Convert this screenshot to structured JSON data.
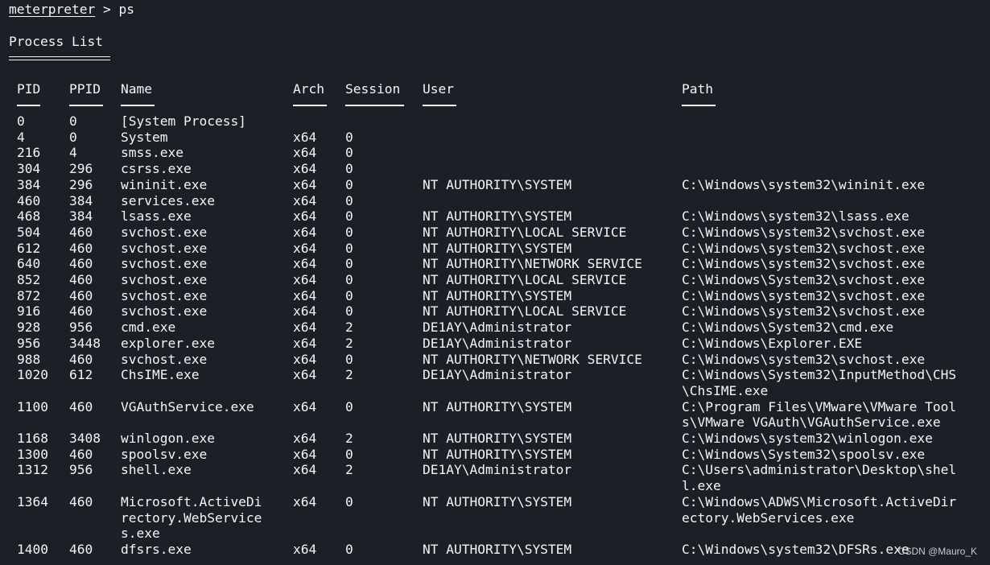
{
  "prompt": {
    "name": "meterpreter",
    "separator": " > ",
    "command": "ps"
  },
  "heading": "Process List",
  "columns": [
    {
      "key": "pid",
      "label": "PID"
    },
    {
      "key": "ppid",
      "label": "PPID"
    },
    {
      "key": "name",
      "label": "Name"
    },
    {
      "key": "arch",
      "label": "Arch"
    },
    {
      "key": "session",
      "label": "Session"
    },
    {
      "key": "user",
      "label": "User"
    },
    {
      "key": "path",
      "label": "Path"
    }
  ],
  "rows": [
    {
      "pid": "0",
      "ppid": "0",
      "name": [
        "[System Process]"
      ],
      "arch": "",
      "session": "",
      "user": "",
      "path": []
    },
    {
      "pid": "4",
      "ppid": "0",
      "name": [
        "System"
      ],
      "arch": "x64",
      "session": "0",
      "user": "",
      "path": []
    },
    {
      "pid": "216",
      "ppid": "4",
      "name": [
        "smss.exe"
      ],
      "arch": "x64",
      "session": "0",
      "user": "",
      "path": []
    },
    {
      "pid": "304",
      "ppid": "296",
      "name": [
        "csrss.exe"
      ],
      "arch": "x64",
      "session": "0",
      "user": "",
      "path": []
    },
    {
      "pid": "384",
      "ppid": "296",
      "name": [
        "wininit.exe"
      ],
      "arch": "x64",
      "session": "0",
      "user": "NT AUTHORITY\\SYSTEM",
      "path": [
        "C:\\Windows\\system32\\wininit.exe"
      ]
    },
    {
      "pid": "460",
      "ppid": "384",
      "name": [
        "services.exe"
      ],
      "arch": "x64",
      "session": "0",
      "user": "",
      "path": []
    },
    {
      "pid": "468",
      "ppid": "384",
      "name": [
        "lsass.exe"
      ],
      "arch": "x64",
      "session": "0",
      "user": "NT AUTHORITY\\SYSTEM",
      "path": [
        "C:\\Windows\\system32\\lsass.exe"
      ]
    },
    {
      "pid": "504",
      "ppid": "460",
      "name": [
        "svchost.exe"
      ],
      "arch": "x64",
      "session": "0",
      "user": "NT AUTHORITY\\LOCAL SERVICE",
      "path": [
        "C:\\Windows\\system32\\svchost.exe"
      ]
    },
    {
      "pid": "612",
      "ppid": "460",
      "name": [
        "svchost.exe"
      ],
      "arch": "x64",
      "session": "0",
      "user": "NT AUTHORITY\\SYSTEM",
      "path": [
        "C:\\Windows\\system32\\svchost.exe"
      ]
    },
    {
      "pid": "640",
      "ppid": "460",
      "name": [
        "svchost.exe"
      ],
      "arch": "x64",
      "session": "0",
      "user": "NT AUTHORITY\\NETWORK SERVICE",
      "path": [
        "C:\\Windows\\system32\\svchost.exe"
      ]
    },
    {
      "pid": "852",
      "ppid": "460",
      "name": [
        "svchost.exe"
      ],
      "arch": "x64",
      "session": "0",
      "user": "NT AUTHORITY\\LOCAL SERVICE",
      "path": [
        "C:\\Windows\\System32\\svchost.exe"
      ]
    },
    {
      "pid": "872",
      "ppid": "460",
      "name": [
        "svchost.exe"
      ],
      "arch": "x64",
      "session": "0",
      "user": "NT AUTHORITY\\SYSTEM",
      "path": [
        "C:\\Windows\\system32\\svchost.exe"
      ]
    },
    {
      "pid": "916",
      "ppid": "460",
      "name": [
        "svchost.exe"
      ],
      "arch": "x64",
      "session": "0",
      "user": "NT AUTHORITY\\LOCAL SERVICE",
      "path": [
        "C:\\Windows\\system32\\svchost.exe"
      ]
    },
    {
      "pid": "928",
      "ppid": "956",
      "name": [
        "cmd.exe"
      ],
      "arch": "x64",
      "session": "2",
      "user": "DE1AY\\Administrator",
      "path": [
        "C:\\Windows\\System32\\cmd.exe"
      ]
    },
    {
      "pid": "956",
      "ppid": "3448",
      "name": [
        "explorer.exe"
      ],
      "arch": "x64",
      "session": "2",
      "user": "DE1AY\\Administrator",
      "path": [
        "C:\\Windows\\Explorer.EXE"
      ]
    },
    {
      "pid": "988",
      "ppid": "460",
      "name": [
        "svchost.exe"
      ],
      "arch": "x64",
      "session": "0",
      "user": "NT AUTHORITY\\NETWORK SERVICE",
      "path": [
        "C:\\Windows\\system32\\svchost.exe"
      ]
    },
    {
      "pid": "1020",
      "ppid": "612",
      "name": [
        "ChsIME.exe"
      ],
      "arch": "x64",
      "session": "2",
      "user": "DE1AY\\Administrator",
      "path": [
        "C:\\Windows\\System32\\InputMethod\\CHS",
        "\\ChsIME.exe"
      ]
    },
    {
      "pid": "1100",
      "ppid": "460",
      "name": [
        "VGAuthService.exe"
      ],
      "arch": "x64",
      "session": "0",
      "user": "NT AUTHORITY\\SYSTEM",
      "path": [
        "C:\\Program Files\\VMware\\VMware Tool",
        "s\\VMware VGAuth\\VGAuthService.exe"
      ]
    },
    {
      "pid": "1168",
      "ppid": "3408",
      "name": [
        "winlogon.exe"
      ],
      "arch": "x64",
      "session": "2",
      "user": "NT AUTHORITY\\SYSTEM",
      "path": [
        "C:\\Windows\\system32\\winlogon.exe"
      ]
    },
    {
      "pid": "1300",
      "ppid": "460",
      "name": [
        "spoolsv.exe"
      ],
      "arch": "x64",
      "session": "0",
      "user": "NT AUTHORITY\\SYSTEM",
      "path": [
        "C:\\Windows\\System32\\spoolsv.exe"
      ]
    },
    {
      "pid": "1312",
      "ppid": "956",
      "name": [
        "shell.exe"
      ],
      "arch": "x64",
      "session": "2",
      "user": "DE1AY\\Administrator",
      "path": [
        "C:\\Users\\administrator\\Desktop\\shel",
        "l.exe"
      ]
    },
    {
      "pid": "1364",
      "ppid": "460",
      "name": [
        "Microsoft.ActiveDi",
        "rectory.WebService",
        "s.exe"
      ],
      "arch": "x64",
      "session": "0",
      "user": "NT AUTHORITY\\SYSTEM",
      "path": [
        "C:\\Windows\\ADWS\\Microsoft.ActiveDir",
        "ectory.WebServices.exe"
      ]
    },
    {
      "pid": "1400",
      "ppid": "460",
      "name": [
        "dfsrs.exe"
      ],
      "arch": "x64",
      "session": "0",
      "user": "NT AUTHORITY\\SYSTEM",
      "path": [
        "C:\\Windows\\system32\\DFSRs.exe"
      ]
    }
  ],
  "watermark": "CSDN @Mauro_K",
  "colors": {
    "background": "#1d1f27",
    "foreground": "#f4f5f7"
  }
}
